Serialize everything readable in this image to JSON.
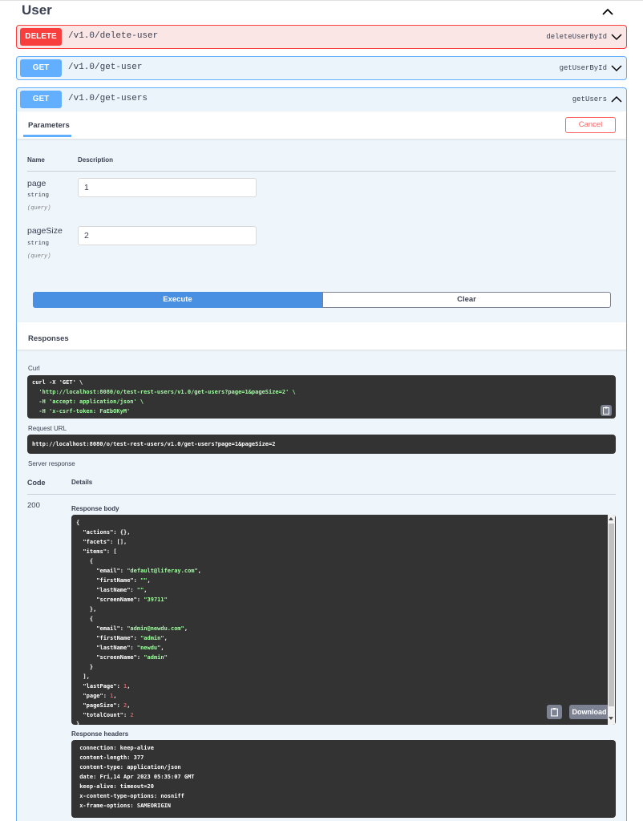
{
  "tag": {
    "title": "User"
  },
  "operations": {
    "delete_user": {
      "method": "DELETE",
      "path": "/v1.0/delete-user",
      "operation_id": "deleteUserById"
    },
    "get_user": {
      "method": "GET",
      "path": "/v1.0/get-user",
      "operation_id": "getUserById"
    },
    "get_users": {
      "method": "GET",
      "path": "/v1.0/get-users",
      "operation_id": "getUsers"
    }
  },
  "parameters": {
    "tab_label": "Parameters",
    "cancel_label": "Cancel",
    "col_name": "Name",
    "col_description": "Description",
    "items": [
      {
        "name": "page",
        "type": "string",
        "in": "(query)",
        "value": "1"
      },
      {
        "name": "pageSize",
        "type": "string",
        "in": "(query)",
        "value": "2"
      }
    ],
    "execute_label": "Execute",
    "clear_label": "Clear"
  },
  "responses": {
    "title": "Responses",
    "curl_label": "Curl",
    "curl_lines": [
      "curl -X 'GET' \\",
      "  'http://localhost:8080/o/test-rest-users/v1.0/get-users?page=1&pageSize=2' \\",
      "  -H 'accept: application/json' \\",
      "  -H 'x-csrf-token: FaEbOKyM'"
    ],
    "request_url_label": "Request URL",
    "request_url": "http://localhost:8080/o/test-rest-users/v1.0/get-users?page=1&pageSize=2",
    "server_response_label": "Server response",
    "col_code": "Code",
    "col_details": "Details",
    "status_code": "200",
    "response_body_label": "Response body",
    "response_body_lines": [
      "{",
      "  \"actions\": {},",
      "  \"facets\": [],",
      "  \"items\": [",
      "    {",
      "      \"email\": \"default@liferay.com\",",
      "      \"firstName\": \"\",",
      "      \"lastName\": \"\",",
      "      \"screenName\": \"39711\"",
      "    },",
      "    {",
      "      \"email\": \"admin@newdu.com\",",
      "      \"firstName\": \"admin\",",
      "      \"lastName\": \"newdu\",",
      "      \"screenName\": \"admin\"",
      "    }",
      "  ],",
      "  \"lastPage\": 1,",
      "  \"page\": 1,",
      "  \"pageSize\": 2,",
      "  \"totalCount\": 2",
      "}"
    ],
    "download_label": "Download",
    "response_headers_label": "Response headers",
    "response_headers_lines": [
      " connection: keep-alive ",
      " content-length: 377 ",
      " content-type: application/json ",
      " date: Fri,14 Apr 2023 05:35:07 GMT ",
      " keep-alive: timeout=20 ",
      " x-content-type-options: nosniff ",
      " x-frame-options: SAMEORIGIN "
    ]
  },
  "colors": {
    "delete": "#f93e3e",
    "get": "#61affe",
    "execute": "#4990e2",
    "code_bg": "#333333",
    "string": "#a2fca2",
    "number": "#d36363"
  }
}
